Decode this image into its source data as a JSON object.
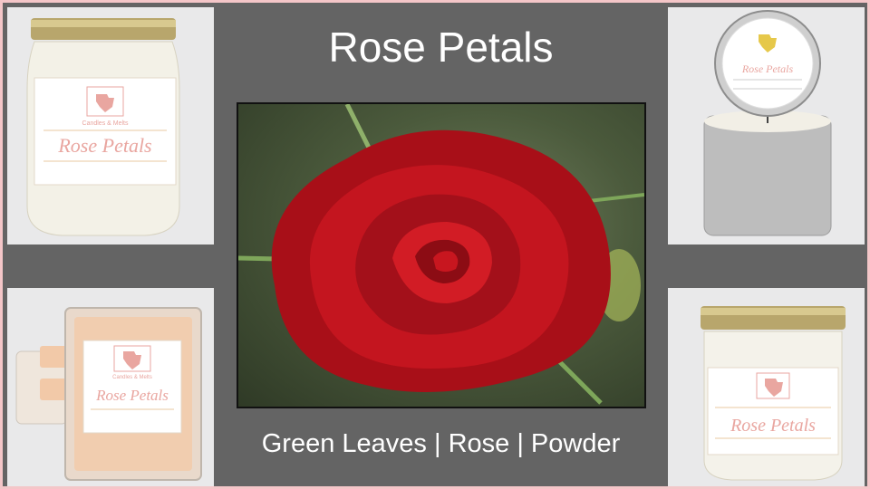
{
  "title": "Rose Petals",
  "notes": "Green Leaves | Rose | Powder",
  "product_label": {
    "name": "Rose Petals",
    "brand": "Candles & Melts"
  },
  "colors": {
    "background_gray": "#646464",
    "border_pink": "#f4c6c8",
    "label_pink": "#e9a6a0",
    "rose_red": "#b3131b"
  }
}
